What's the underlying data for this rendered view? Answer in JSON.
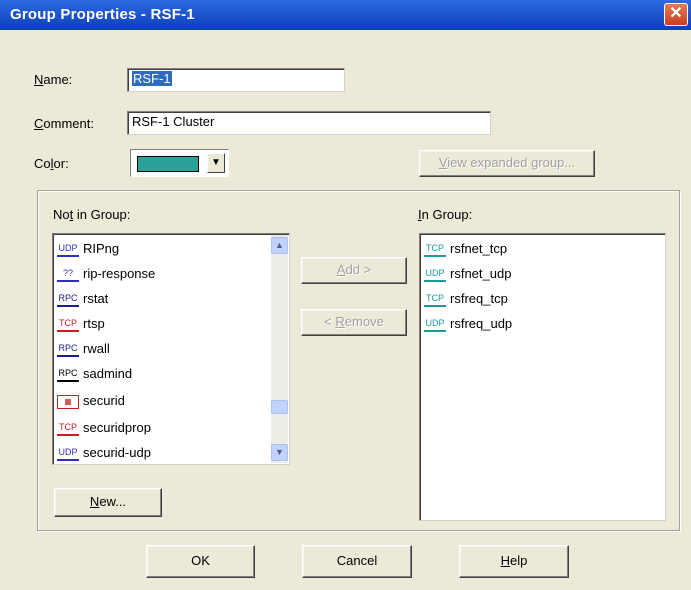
{
  "window": {
    "title": "Group Properties - RSF-1",
    "close_icon": "close-icon"
  },
  "form": {
    "name_label_prefix": "N",
    "name_label_rest": "ame:",
    "name_value": "RSF-1",
    "comment_label_prefix": "C",
    "comment_label_rest": "omment:",
    "comment_value": "RSF-1 Cluster",
    "color_label_prefix": "Co",
    "color_label_u": "l",
    "color_label_rest": "or:",
    "color_value": "#2aa198",
    "view_expanded_prefix": "V",
    "view_expanded_rest": "iew expanded group..."
  },
  "not_in_group": {
    "label_prefix": "No",
    "label_u": "t",
    "label_rest": " in Group:",
    "items": [
      {
        "icon": "UDP",
        "icon_name": "udp-icon",
        "label": "RIPng"
      },
      {
        "icon": "??",
        "icon_name": "unknown-service-icon",
        "label": "rip-response"
      },
      {
        "icon": "RPC",
        "icon_name": "rpc-icon",
        "label": "rstat"
      },
      {
        "icon": "TCP",
        "icon_name": "tcp-icon",
        "label": "rtsp"
      },
      {
        "icon": "RPC",
        "icon_name": "rpc-icon",
        "label": "rwall"
      },
      {
        "icon": "RPC",
        "icon_name": "rpc-icon",
        "label": "sadmind"
      },
      {
        "icon": "▦",
        "icon_name": "group-icon",
        "label": "securid"
      },
      {
        "icon": "TCP",
        "icon_name": "tcp-icon",
        "label": "securidprop"
      },
      {
        "icon": "UDP",
        "icon_name": "udp-icon",
        "label": "securid-udp"
      }
    ]
  },
  "in_group": {
    "label_prefix": "I",
    "label_rest": "n Group:",
    "items": [
      {
        "icon": "TCP",
        "icon_name": "tcp-icon",
        "label": "rsfnet_tcp"
      },
      {
        "icon": "UDP",
        "icon_name": "udp-icon",
        "label": "rsfnet_udp"
      },
      {
        "icon": "TCP",
        "icon_name": "tcp-icon",
        "label": "rsfreq_tcp"
      },
      {
        "icon": "UDP",
        "icon_name": "udp-icon",
        "label": "rsfreq_udp"
      }
    ]
  },
  "buttons": {
    "add_prefix": "A",
    "add_rest": "dd  >",
    "remove_prefix": "<  ",
    "remove_u": "R",
    "remove_rest": "emove",
    "new_prefix": "N",
    "new_rest": "ew...",
    "ok": "OK",
    "cancel": "Cancel",
    "help_prefix": "H",
    "help_rest": "elp"
  }
}
